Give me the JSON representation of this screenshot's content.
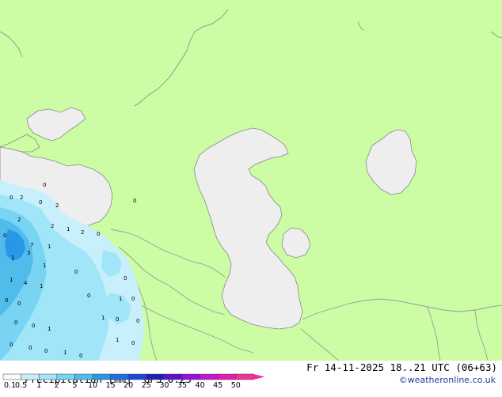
{
  "header": {
    "left_label": "Precipitation [mm]",
    "model": "GFS 0.25",
    "valid_time": "Fr 14-11-2025 18..21 UTC (06+63)",
    "credit": "©weatheronline.co.uk"
  },
  "legend": {
    "ticks": [
      "0.1",
      "0.5",
      "1",
      "2",
      "5",
      "10",
      "15",
      "20",
      "25",
      "30",
      "35",
      "40",
      "45",
      "50"
    ],
    "colors": [
      "#f5fbff",
      "#c8f0fc",
      "#a0e6f8",
      "#78d4f2",
      "#50bcec",
      "#2898e6",
      "#1e6ee0",
      "#1e46d6",
      "#2020b8",
      "#6010c8",
      "#9a10d8",
      "#c814d2",
      "#e61ab4",
      "#f03296"
    ]
  },
  "map": {
    "land_color": "#ccfca4",
    "sea_color": "#eeeeee",
    "border_color": "#9a9a9a",
    "coast_color": "#888888"
  },
  "precip_labels": [
    "0",
    "2",
    "0",
    "2",
    "2",
    "2",
    "1",
    "2",
    "0",
    "0",
    "7",
    "1",
    "1",
    "3",
    "1",
    "0",
    "1",
    "4",
    "1",
    "0",
    "0",
    "1",
    "0",
    "0",
    "0",
    "1",
    "0",
    "0",
    "0",
    "0",
    "1",
    "1",
    "0",
    "0",
    "0",
    "0",
    "1",
    "0"
  ]
}
